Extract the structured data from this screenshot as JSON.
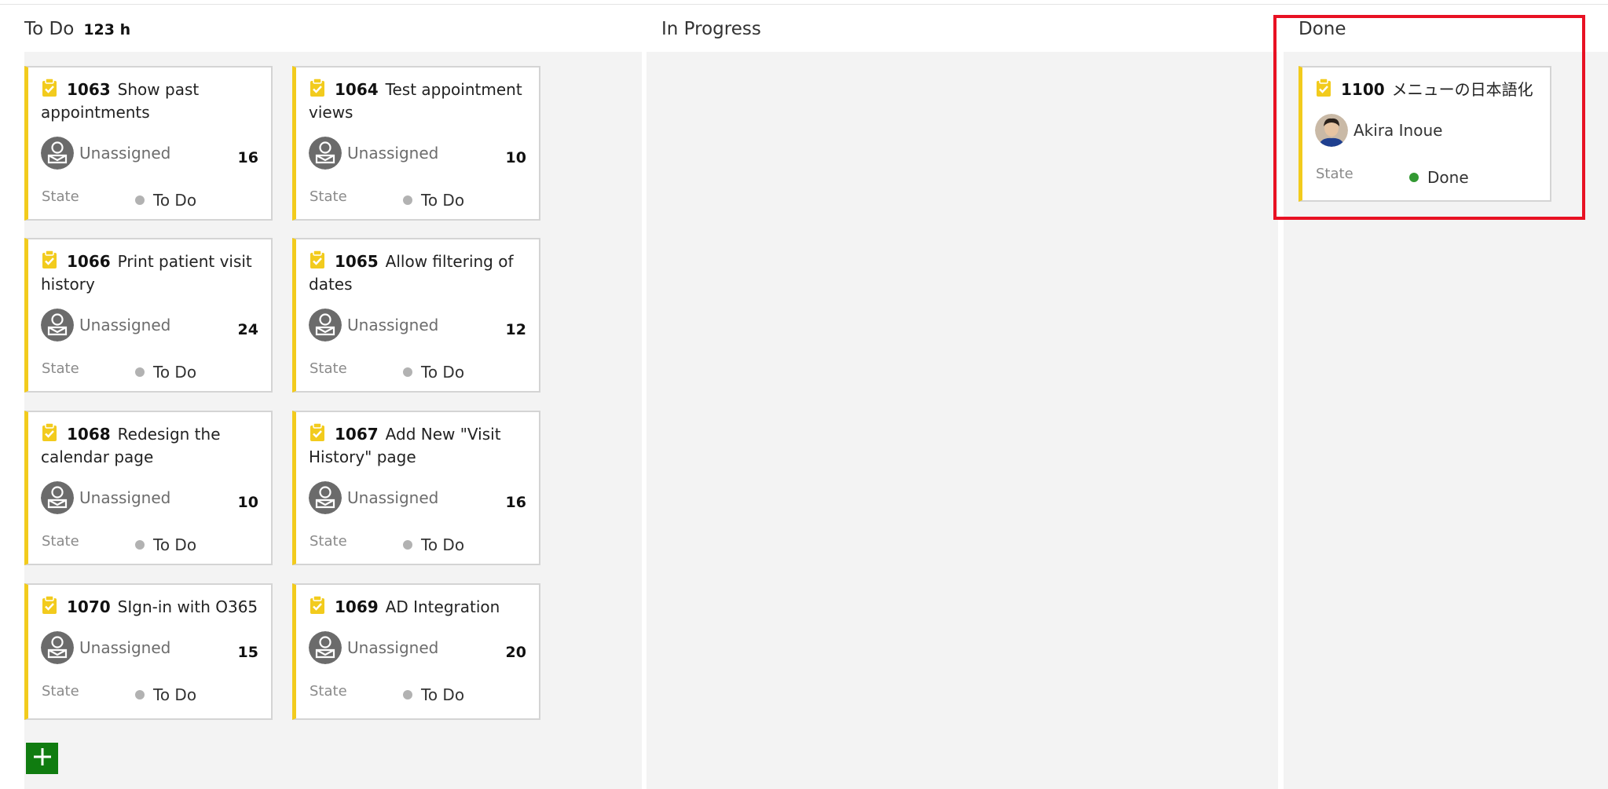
{
  "board": {
    "todo": {
      "title": "To Do",
      "total": "123 h",
      "cards": [
        {
          "id": "1063",
          "title": "Show past appointments",
          "assignee": "Unassigned",
          "hours": "16",
          "state_label": "State",
          "state": "To Do"
        },
        {
          "id": "1064",
          "title": "Test appointment views",
          "assignee": "Unassigned",
          "hours": "10",
          "state_label": "State",
          "state": "To Do"
        },
        {
          "id": "1066",
          "title": "Print patient visit history",
          "assignee": "Unassigned",
          "hours": "24",
          "state_label": "State",
          "state": "To Do"
        },
        {
          "id": "1065",
          "title": "Allow filtering of dates",
          "assignee": "Unassigned",
          "hours": "12",
          "state_label": "State",
          "state": "To Do"
        },
        {
          "id": "1068",
          "title": "Redesign the calendar page",
          "assignee": "Unassigned",
          "hours": "10",
          "state_label": "State",
          "state": "To Do"
        },
        {
          "id": "1067",
          "title": "Add New \"Visit History\" page",
          "assignee": "Unassigned",
          "hours": "16",
          "state_label": "State",
          "state": "To Do"
        },
        {
          "id": "1070",
          "title": "SIgn-in with O365",
          "assignee": "Unassigned",
          "hours": "15",
          "state_label": "State",
          "state": "To Do"
        },
        {
          "id": "1069",
          "title": "AD Integration",
          "assignee": "Unassigned",
          "hours": "20",
          "state_label": "State",
          "state": "To Do"
        }
      ]
    },
    "in_progress": {
      "title": "In Progress"
    },
    "done": {
      "title": "Done",
      "cards": [
        {
          "id": "1100",
          "title": "メニューの日本語化",
          "assignee": "Akira Inoue",
          "state_label": "State",
          "state": "Done"
        }
      ]
    }
  },
  "icons": {
    "task": "clipboard-check-icon",
    "unassigned": "unassigned-user-icon",
    "add": "plus-icon",
    "todo_dot": "gray-dot",
    "done_dot": "green-dot"
  },
  "colors": {
    "card_accent": "#f2cb1d",
    "done_dot": "#339933",
    "todo_dot": "#b2b2b2",
    "add_button": "#107c10",
    "highlight": "#e81123",
    "column_bg": "#f3f3f3"
  }
}
